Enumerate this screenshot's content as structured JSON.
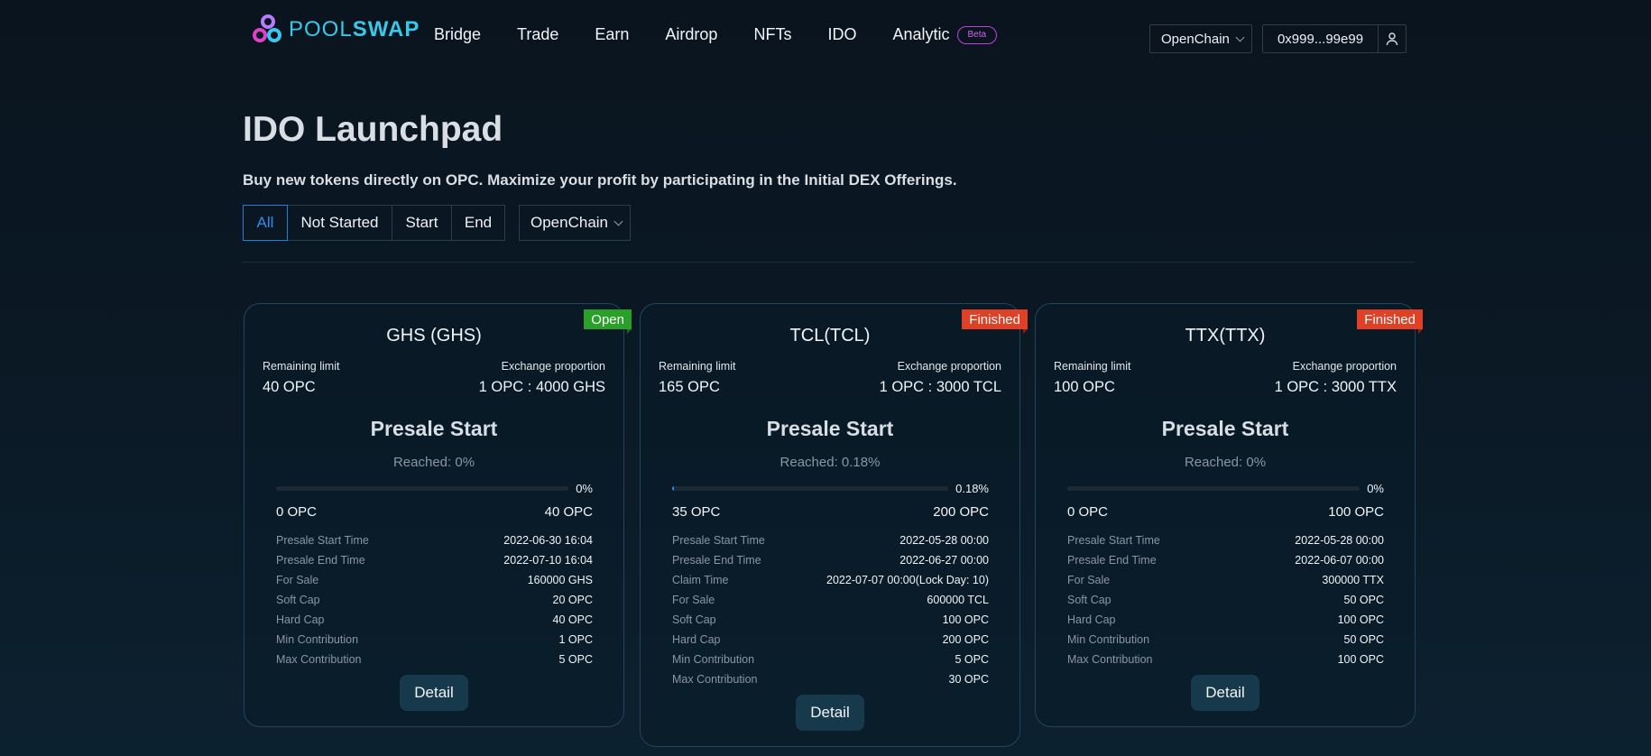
{
  "header": {
    "logo": {
      "pool": "POOL",
      "swap": "SWAP"
    },
    "nav": [
      "Bridge",
      "Trade",
      "Earn",
      "Airdrop",
      "NFTs",
      "IDO",
      "Analytic"
    ],
    "beta_badge": "Beta",
    "chain_select": "OpenChain",
    "wallet_address": "0x999...99e99"
  },
  "page": {
    "title": "IDO Launchpad",
    "subtitle": "Buy new tokens directly on OPC. Maximize your profit by participating in the Initial DEX Offerings.",
    "filters": [
      "All",
      "Not Started",
      "Start",
      "End"
    ],
    "active_filter": "All",
    "chain_filter": "OpenChain"
  },
  "cards": [
    {
      "status": "Open",
      "title": "GHS (GHS)",
      "remaining_label": "Remaining limit",
      "remaining_value": "40 OPC",
      "exchange_label": "Exchange proportion",
      "exchange_value": "1 OPC : 4000 GHS",
      "presale_title": "Presale Start",
      "reached": "Reached: 0%",
      "progress_pct": "0%",
      "progress": 0,
      "min_amount": "0 OPC",
      "max_amount": "40 OPC",
      "details": [
        {
          "label": "Presale Start Time",
          "value": "2022-06-30 16:04"
        },
        {
          "label": "Presale End Time",
          "value": "2022-07-10 16:04"
        },
        {
          "label": "For Sale",
          "value": "160000 GHS"
        },
        {
          "label": "Soft Cap",
          "value": "20 OPC"
        },
        {
          "label": "Hard Cap",
          "value": "40 OPC"
        },
        {
          "label": "Min Contribution",
          "value": "1 OPC"
        },
        {
          "label": "Max Contribution",
          "value": "5 OPC"
        }
      ],
      "button": "Detail"
    },
    {
      "status": "Finished",
      "title": "TCL(TCL)",
      "remaining_label": "Remaining limit",
      "remaining_value": "165 OPC",
      "exchange_label": "Exchange proportion",
      "exchange_value": "1 OPC : 3000 TCL",
      "presale_title": "Presale Start",
      "reached": "Reached: 0.18%",
      "progress_pct": "0.18%",
      "progress": 0.18,
      "min_amount": "35 OPC",
      "max_amount": "200 OPC",
      "details": [
        {
          "label": "Presale Start Time",
          "value": "2022-05-28 00:00"
        },
        {
          "label": "Presale End Time",
          "value": "2022-06-27 00:00"
        },
        {
          "label": "Claim Time",
          "value": "2022-07-07 00:00(Lock Day: 10)"
        },
        {
          "label": "For Sale",
          "value": "600000 TCL"
        },
        {
          "label": "Soft Cap",
          "value": "100 OPC"
        },
        {
          "label": "Hard Cap",
          "value": "200 OPC"
        },
        {
          "label": "Min Contribution",
          "value": "5 OPC"
        },
        {
          "label": "Max Contribution",
          "value": "30 OPC"
        }
      ],
      "button": "Detail"
    },
    {
      "status": "Finished",
      "title": "TTX(TTX)",
      "remaining_label": "Remaining limit",
      "remaining_value": "100 OPC",
      "exchange_label": "Exchange proportion",
      "exchange_value": "1 OPC : 3000 TTX",
      "presale_title": "Presale Start",
      "reached": "Reached: 0%",
      "progress_pct": "0%",
      "progress": 0,
      "min_amount": "0 OPC",
      "max_amount": "100 OPC",
      "details": [
        {
          "label": "Presale Start Time",
          "value": "2022-05-28 00:00"
        },
        {
          "label": "Presale End Time",
          "value": "2022-06-07 00:00"
        },
        {
          "label": "For Sale",
          "value": "300000 TTX"
        },
        {
          "label": "Soft Cap",
          "value": "50 OPC"
        },
        {
          "label": "Hard Cap",
          "value": "100 OPC"
        },
        {
          "label": "Min Contribution",
          "value": "50 OPC"
        },
        {
          "label": "Max Contribution",
          "value": "100 OPC"
        }
      ],
      "button": "Detail"
    }
  ]
}
